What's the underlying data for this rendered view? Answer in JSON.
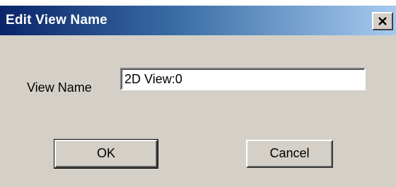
{
  "window": {
    "title": "Edit View Name"
  },
  "form": {
    "view_name_label": "View Name",
    "view_name_value": "2D View:0"
  },
  "buttons": {
    "ok_label": "OK",
    "cancel_label": "Cancel"
  },
  "icons": {
    "close": "close-icon"
  },
  "colors": {
    "titlebar_start": "#0a246a",
    "titlebar_end": "#a6caf0",
    "dialog_face": "#d4d0c8"
  }
}
